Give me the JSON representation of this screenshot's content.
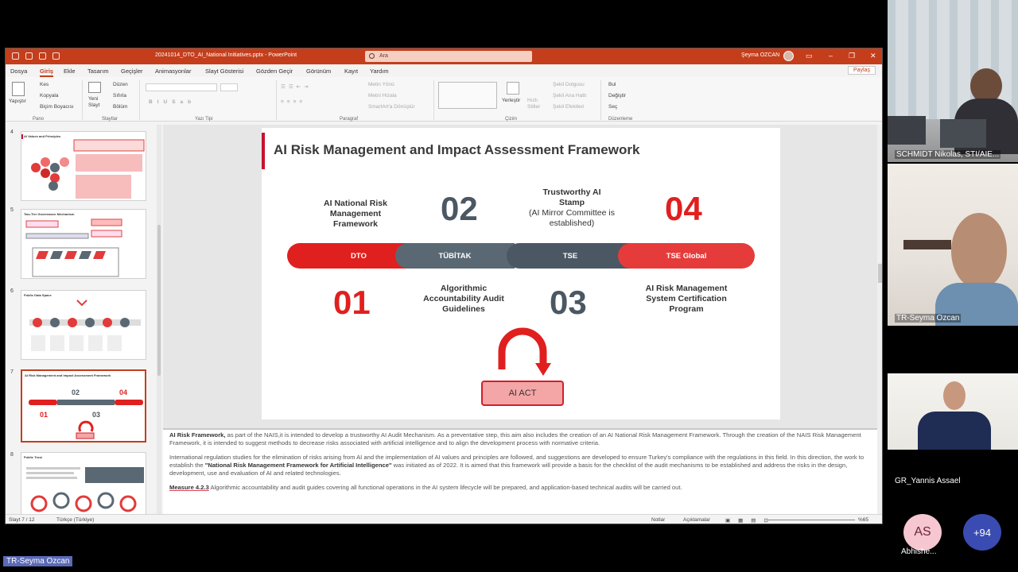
{
  "ppt": {
    "filename": "20241014_DTO_AI_National Initiatives.pptx - PowerPoint",
    "search_placeholder": "Ara",
    "user": "Şeyma OZCAN",
    "menus": [
      "Dosya",
      "Giriş",
      "Ekle",
      "Tasarım",
      "Geçişler",
      "Animasyonlar",
      "Slayt Gösterisi",
      "Gözden Geçir",
      "Görünüm",
      "Kayıt",
      "Yardım"
    ],
    "share": "Paylaş",
    "ribbon": {
      "paste": "Yapıştır",
      "cut": "Kes",
      "copy": "Kopyala",
      "format_painter": "Biçim Boyacısı",
      "new_slide": "Yeni Slayt",
      "layout": "Düzen",
      "reset": "Sıfırla",
      "section": "Bölüm",
      "text_direction": "Metin Yönü",
      "align_text": "Metni Hizala",
      "smartart": "SmartArt'a Dönüştür",
      "arrange": "Yerleştir",
      "quick_styles": "Hızlı Stiller",
      "shape_fill": "Şekil Dolgusu",
      "shape_outline": "Şekil Ana Hattı",
      "shape_effects": "Şekil Efektleri",
      "find": "Bul",
      "replace": "Değiştir",
      "select": "Seç",
      "groups": [
        "Pano",
        "Slaytlar",
        "Yazı Tipi",
        "Paragraf",
        "Çizim",
        "Düzenleme"
      ]
    },
    "thumbnails": [
      {
        "num": "4",
        "title": "AI Values and Principles"
      },
      {
        "num": "5",
        "title": "Two-Tier Governance Mechanism"
      },
      {
        "num": "6",
        "title": "Public Data Space"
      },
      {
        "num": "7",
        "title": "AI Risk Management and Impact Assessment Framework"
      },
      {
        "num": "8",
        "title": "Public Trust"
      }
    ],
    "slide": {
      "title": "AI Risk Management and Impact Assessment Framework",
      "top_left_label": "AI National Risk Management Framework",
      "num_02": "02",
      "trustworthy_title": "Trustworthy AI Stamp",
      "trustworthy_sub": "(AI Mirror Committee is established)",
      "num_04": "04",
      "segments": [
        "DTO",
        "TÜBİTAK",
        "TSE",
        "TSE Global"
      ],
      "num_01": "01",
      "algo_label": "Algorithmic Accountability Audit Guidelines",
      "num_03": "03",
      "cert_label": "AI Risk Management System Certification Program",
      "ai_act": "AI ACT"
    },
    "notes": {
      "p1_bold": "AI Risk Framework,",
      "p1_text": " as part of the NAIS,it is intended to develop a trustworthy AI Audit Mechanism. As a preventative step, this aim also includes the creation of an AI National Risk Management Framework. Through the creation of the NAIS Risk Management Framework, it is intended to suggest methods to decrease risks associated with artificial intelligence and to align the development process with normative criteria.",
      "p2_a": "International regulation studies for the elimination of risks arising from AI and the implementation of AI values and principles are followed, and suggestions are developed to ensure Turkey's compliance with the regulations in this field. In this direction, the work to establish the ",
      "p2_bold": "\"National Risk Management Framework for Artificial Intelligence\"",
      "p2_b": " was initiated as of 2022. It is aimed that this framework will provide a basis for the checklist of the audit mechanisms to be established and address the risks in the design, development, use and evaluation of AI and related technologies.",
      "p3_bold": "Measure 4.2.3",
      "p3_text": " Algorithmic accountability and audit guides covering all functional operations in the AI system  lifecycle will be prepared, and application-based technical audits will be carried out."
    },
    "status": {
      "slide_count": "Slayt 7 / 12",
      "language": "Türkçe (Türkiye)",
      "notes": "Notlar",
      "comments": "Açıklamalar",
      "zoom": "%65"
    }
  },
  "teams": {
    "tile1_name": "SCHMIDT Nikolas, STI/AIE...",
    "tile2_name": "TR-Seyma Ozcan",
    "tile3_name": "GR_Yannis Assael",
    "avatar_initials": "AS",
    "avatar_name": "Abhishe...",
    "more_count": "+94",
    "presenter_name": "TR-Seyma Ozcan"
  },
  "colors": {
    "ppt_accent": "#c43e1c",
    "slide_red": "#e0201f",
    "slide_grey": "#4b5863",
    "teams_blue": "#3a4cb1"
  }
}
